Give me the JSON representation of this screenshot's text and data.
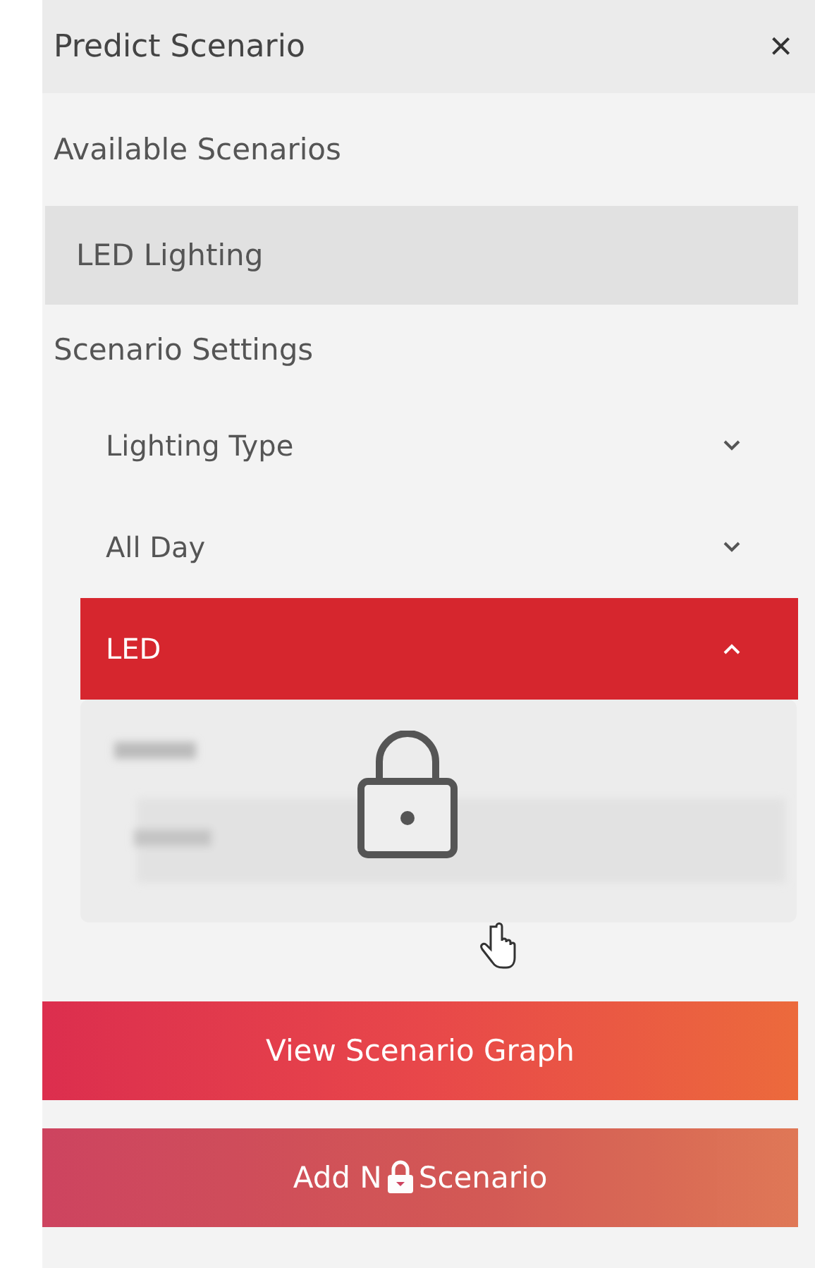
{
  "panel": {
    "title": "Predict Scenario",
    "close": "×"
  },
  "available": {
    "heading": "Available Scenarios",
    "items": [
      {
        "label": "LED Lighting",
        "selected": true
      }
    ]
  },
  "settings": {
    "heading": "Scenario Settings",
    "dropdowns": [
      {
        "label": "Lighting Type",
        "expanded": false
      },
      {
        "label": "All Day",
        "expanded": false
      },
      {
        "label": "LED",
        "expanded": true,
        "locked": true
      }
    ]
  },
  "buttons": [
    {
      "kind": "plain",
      "label": "View Scenario Graph"
    },
    {
      "kind": "locked",
      "label_before": "Add N",
      "label_after": "Scenario"
    }
  ]
}
